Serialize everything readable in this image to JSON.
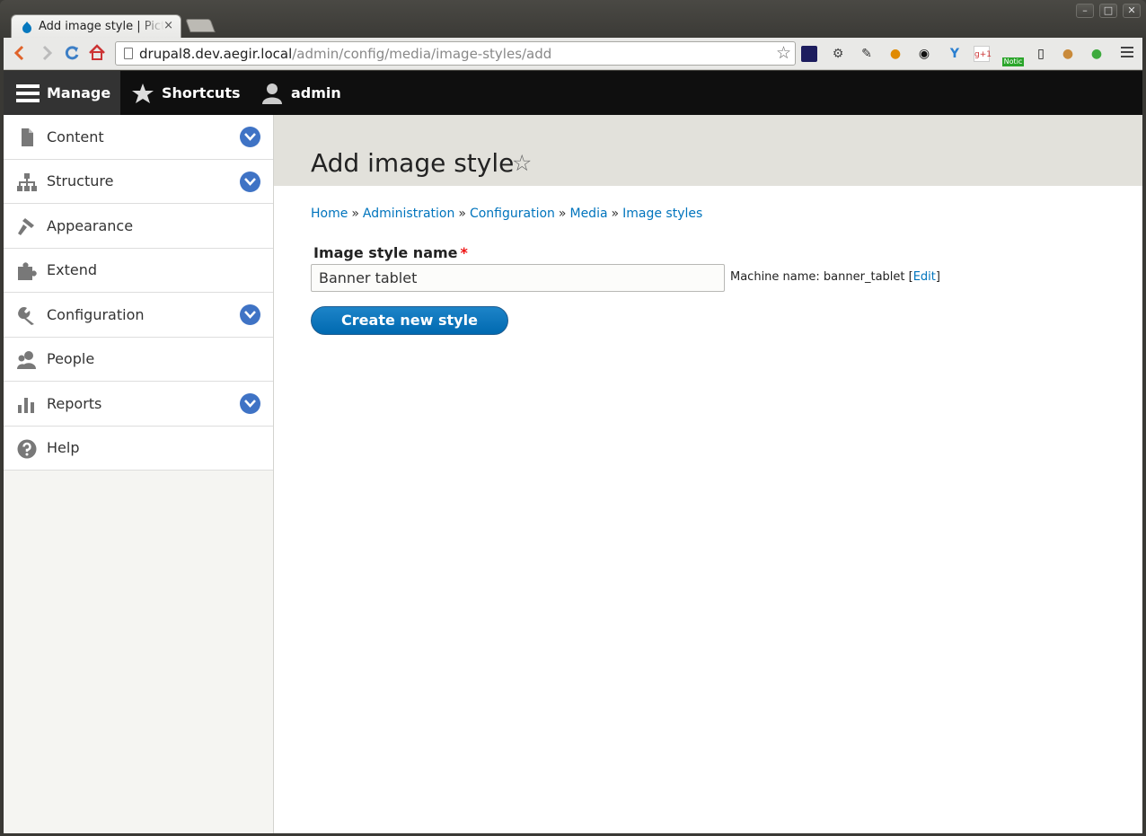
{
  "browser": {
    "tab_title": "Add image style | Picture",
    "tab_close": "×",
    "url_host": "drupal8.dev.aegir.local",
    "url_path": "/admin/config/media/image-styles/add",
    "window_min": "–",
    "window_max": "□",
    "window_close": "✕",
    "ext_badge": "Notic",
    "ext_gplus": "g+1"
  },
  "toolbar": {
    "manage": "Manage",
    "shortcuts": "Shortcuts",
    "user": "admin"
  },
  "sidebar": {
    "items": [
      {
        "label": "Content",
        "icon": "file-icon",
        "expandable": true
      },
      {
        "label": "Structure",
        "icon": "hierarchy-icon",
        "expandable": true
      },
      {
        "label": "Appearance",
        "icon": "paintbrush-icon",
        "expandable": false
      },
      {
        "label": "Extend",
        "icon": "puzzle-icon",
        "expandable": false
      },
      {
        "label": "Configuration",
        "icon": "wrench-icon",
        "expandable": true
      },
      {
        "label": "People",
        "icon": "people-icon",
        "expandable": false
      },
      {
        "label": "Reports",
        "icon": "bar-chart-icon",
        "expandable": true
      },
      {
        "label": "Help",
        "icon": "help-icon",
        "expandable": false
      }
    ]
  },
  "page": {
    "title": "Add image style",
    "breadcrumb": [
      "Home",
      "Administration",
      "Configuration",
      "Media",
      "Image styles"
    ],
    "breadcrumb_sep": "»",
    "field_label": "Image style name",
    "required_mark": "*",
    "field_value": "Banner tablet",
    "machine_name_prefix": "Machine name: banner_tablet [",
    "machine_name_edit": "Edit",
    "machine_name_suffix": "]",
    "submit": "Create new style"
  },
  "colors": {
    "link": "#0074bd",
    "primary_button": "#0071b8",
    "toolbar_bg": "#0f0f0f",
    "header_bg": "#e2e1db",
    "toggle": "#3f73c5"
  }
}
